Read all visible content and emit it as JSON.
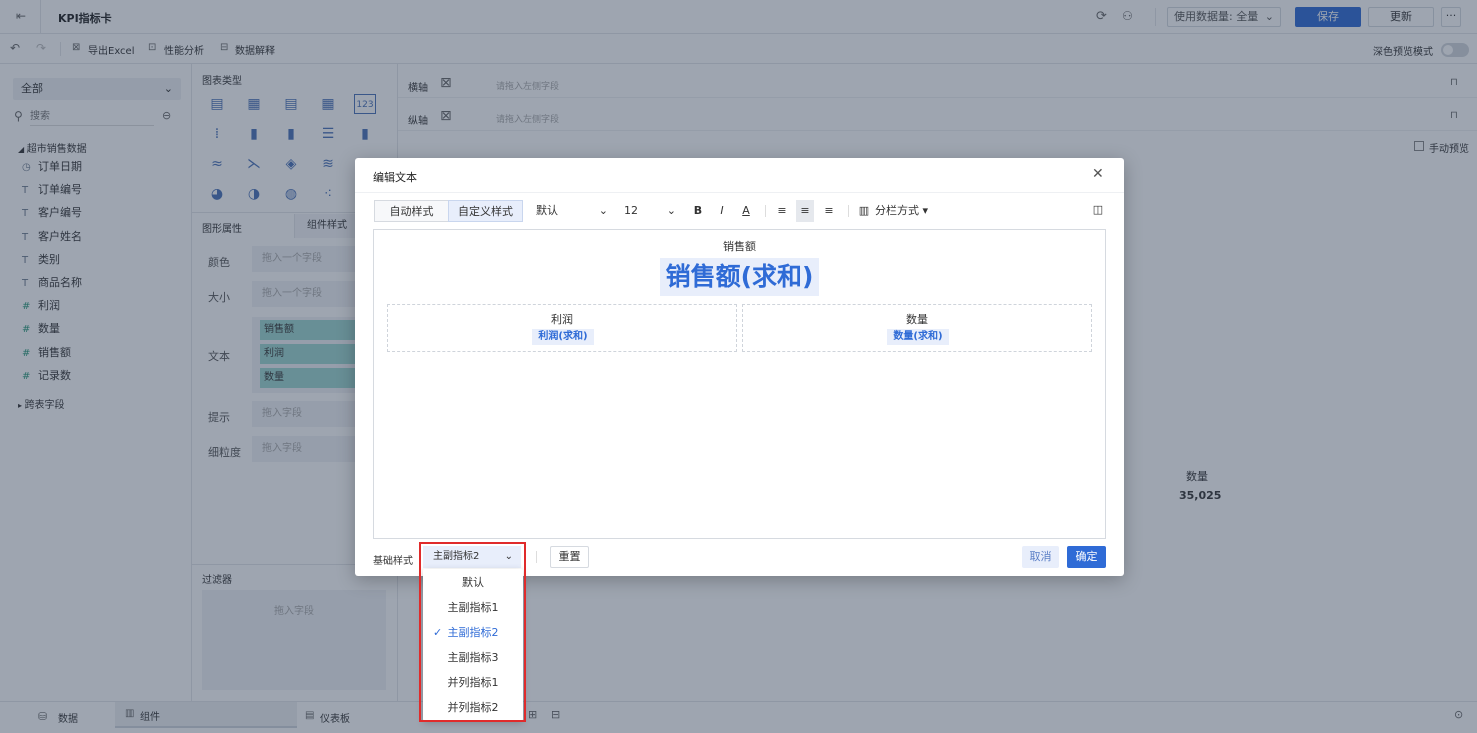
{
  "topbar": {
    "back_icon": "exit-icon",
    "title": "KPI指标卡",
    "data_usage_label": "使用数据量: 全量",
    "save_label": "保存",
    "update_label": "更新",
    "more_label": "···"
  },
  "toolbar": {
    "export_label": "导出Excel",
    "perf_label": "性能分析",
    "explain_label": "数据解释",
    "dark_preview_label": "深色预览模式"
  },
  "left": {
    "scope_select": "全部",
    "search_placeholder": "搜索",
    "dataset_name": "超市销售数据",
    "fields": [
      {
        "type": "date",
        "name": "订单日期"
      },
      {
        "type": "text",
        "name": "订单编号"
      },
      {
        "type": "text",
        "name": "客户编号"
      },
      {
        "type": "text",
        "name": "客户姓名"
      },
      {
        "type": "text",
        "name": "类别"
      },
      {
        "type": "text",
        "name": "商品名称"
      },
      {
        "type": "num",
        "name": "利润"
      },
      {
        "type": "num",
        "name": "数量"
      },
      {
        "type": "num",
        "name": "销售额"
      },
      {
        "type": "num",
        "name": "记录数"
      }
    ],
    "cross_table": "跨表字段"
  },
  "mid": {
    "chart_types_title": "图表类型",
    "tab_props": "图形属性",
    "tab_comp": "组件样式",
    "color_label": "颜色",
    "size_label": "大小",
    "text_label": "文本",
    "tip_label": "提示",
    "granularity_label": "细粒度",
    "drop_field": "拖入一个字段",
    "drop_field2": "拖入字段",
    "pills": [
      {
        "name": "销售额",
        "agg": "求和"
      },
      {
        "name": "利润",
        "agg": "求和"
      },
      {
        "name": "数量",
        "agg": "求和"
      }
    ],
    "filter_title": "过滤器",
    "filter_drop": "拖入字段"
  },
  "main": {
    "x_axis_label": "横轴",
    "y_axis_label": "纵轴",
    "axis_placeholder": "请拖入左侧字段",
    "manual_preview": "手动预览",
    "kpi_label": "数量",
    "kpi_value": "35,025"
  },
  "bottombar": {
    "data_tab": "数据",
    "comp_tab": "组件",
    "dash_tab": "仪表板"
  },
  "dialog": {
    "title": "编辑文本",
    "tab_auto": "自动样式",
    "tab_custom": "自定义样式",
    "font_select": "默认",
    "size_select": "12",
    "column_mode": "分栏方式",
    "main_title": "销售额",
    "main_value": "销售额(求和)",
    "sub1_title": "利润",
    "sub1_value": "利润(求和)",
    "sub2_title": "数量",
    "sub2_value": "数量(求和)",
    "base_style_label": "基础样式",
    "base_style_value": "主副指标2",
    "reset_label": "重置",
    "cancel_label": "取消",
    "ok_label": "确定"
  },
  "dropdown": {
    "options": [
      "默认",
      "主副指标1",
      "主副指标2",
      "主副指标3",
      "并列指标1",
      "并列指标2"
    ],
    "selected": "主副指标2"
  },
  "colors": {
    "accent": "#2f6bd6",
    "highlight": "#e8eefb",
    "annotation": "#e02b2b"
  }
}
